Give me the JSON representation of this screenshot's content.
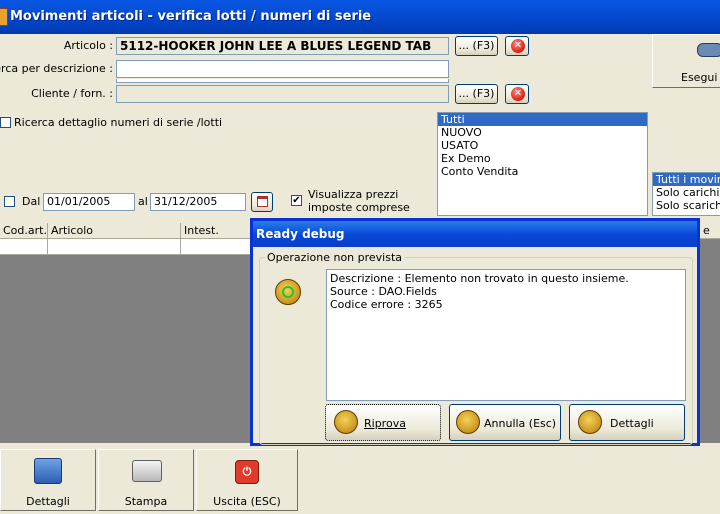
{
  "window": {
    "title": "Movimenti articoli - verifica lotti / numeri di serie"
  },
  "form": {
    "articolo_label": "Articolo :",
    "articolo_value": "5112-HOOKER JOHN LEE A BLUES LEGEND TAB",
    "ricerca_label": "Ricerca per descrizione :",
    "ricerca_value": "",
    "cliente_label": "Cliente / forn. :",
    "cliente_value": "",
    "f3_label": "... (F3)",
    "dettaglio_label": "Ricerca dettaglio numeri di serie /lotti",
    "dal_label": "Dal",
    "dal_value": "01/01/2005",
    "al_label": "al",
    "al_value": "31/12/2005",
    "prezzi_label": "Visualizza prezzi imposte comprese",
    "esegui_label": "Esegui r"
  },
  "stato_list": [
    "Tutti",
    "NUOVO",
    "USATO",
    "Ex Demo",
    "Conto Vendita"
  ],
  "movimenti_list": [
    "Tutti i movime",
    "Solo carichi",
    "Solo scarichi"
  ],
  "grid": {
    "columns": [
      "Cod.art.",
      "Articolo",
      "Intest.",
      "e"
    ]
  },
  "toolbar": {
    "dettagli": "Dettagli",
    "stampa": "Stampa",
    "uscita": "Uscita (ESC)"
  },
  "dialog": {
    "title": "Ready debug",
    "group_label": "Operazione non prevista",
    "lines": [
      "Descrizione : Elemento non trovato in questo insieme.",
      "Source : DAO.Fields",
      "Codice errore : 3265"
    ],
    "riprova": "Riprova",
    "annulla": "Annulla (Esc)",
    "dettagli": "Dettagli"
  }
}
